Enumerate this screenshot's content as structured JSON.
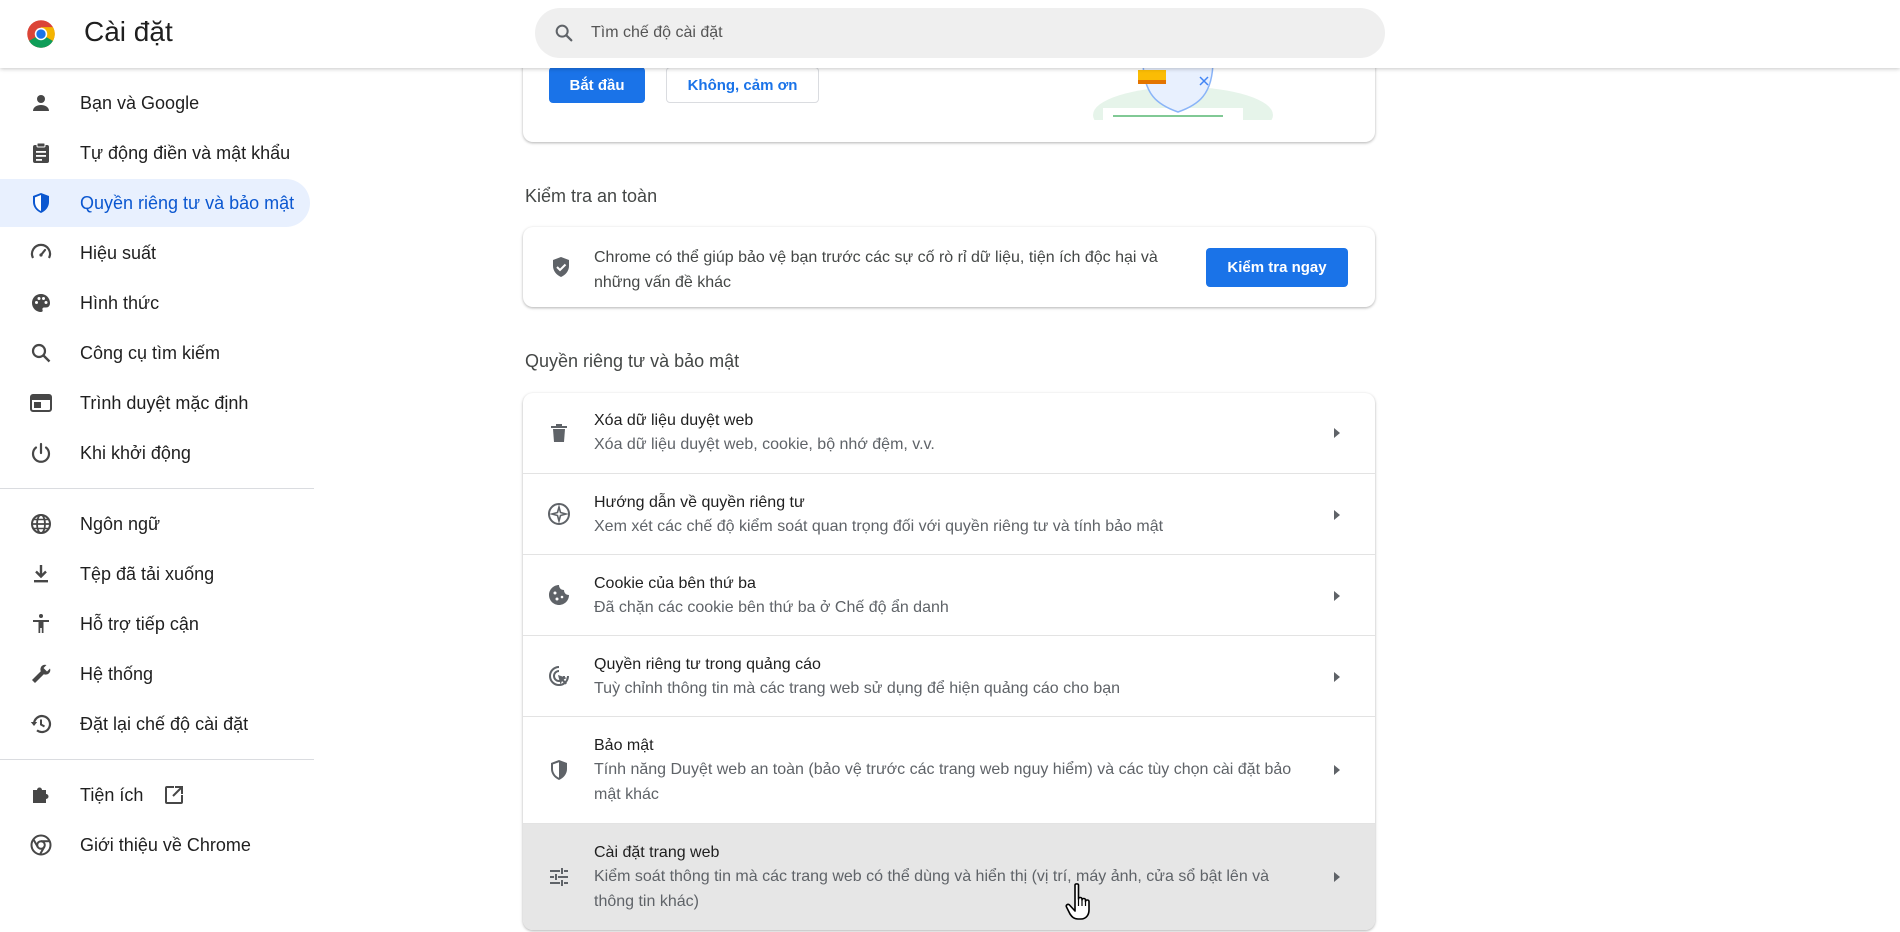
{
  "header": {
    "title": "Cài đặt",
    "search_placeholder": "Tìm chế độ cài đặt"
  },
  "sidebar": {
    "items": [
      {
        "label": "Bạn và Google",
        "icon": "person-icon"
      },
      {
        "label": "Tự động điền và mật khẩu",
        "icon": "clipboard-icon"
      },
      {
        "label": "Quyền riêng tư và bảo mật",
        "icon": "shield-icon",
        "active": true
      },
      {
        "label": "Hiệu suất",
        "icon": "speedometer-icon"
      },
      {
        "label": "Hình thức",
        "icon": "palette-icon"
      },
      {
        "label": "Công cụ tìm kiếm",
        "icon": "search-icon"
      },
      {
        "label": "Trình duyệt mặc định",
        "icon": "browser-icon"
      },
      {
        "label": "Khi khởi động",
        "icon": "power-icon"
      },
      {
        "label": "Ngôn ngữ",
        "icon": "globe-icon"
      },
      {
        "label": "Tệp đã tải xuống",
        "icon": "download-icon"
      },
      {
        "label": "Hỗ trợ tiếp cận",
        "icon": "accessibility-icon"
      },
      {
        "label": "Hệ thống",
        "icon": "wrench-icon"
      },
      {
        "label": "Đặt lại chế độ cài đặt",
        "icon": "history-icon"
      },
      {
        "label": "Tiện ích",
        "icon": "puzzle-icon"
      },
      {
        "label": "Giới thiệu về Chrome",
        "icon": "chrome-icon"
      }
    ]
  },
  "promo": {
    "start_label": "Bắt đầu",
    "no_thanks_label": "Không, cảm ơn"
  },
  "safety_check": {
    "section_title": "Kiểm tra an toàn",
    "description_line1": "Chrome có thể giúp bảo vệ bạn trước các sự cố rò rỉ dữ liệu, tiện ích độc hại và",
    "description_line2": "những vấn đề khác",
    "button_label": "Kiểm tra ngay"
  },
  "privacy": {
    "section_title": "Quyền riêng tư và bảo mật",
    "rows": [
      {
        "title": "Xóa dữ liệu duyệt web",
        "sub": "Xóa dữ liệu duyệt web, cookie, bộ nhớ đệm, v.v.",
        "icon": "trash-icon"
      },
      {
        "title": "Hướng dẫn về quyền riêng tư",
        "sub": "Xem xét các chế độ kiểm soát quan trọng đối với quyền riêng tư và tính bảo mật",
        "icon": "compass-icon"
      },
      {
        "title": "Cookie của bên thứ ba",
        "sub": "Đã chặn các cookie bên thứ ba ở Chế độ ẩn danh",
        "icon": "cookie-icon"
      },
      {
        "title": "Quyền riêng tư trong quảng cáo",
        "sub": "Tuỳ chỉnh thông tin mà các trang web sử dụng để hiện quảng cáo cho bạn",
        "icon": "ad-privacy-icon"
      },
      {
        "title": "Bảo mật",
        "sub": "Tính năng Duyệt web an toàn (bảo vệ trước các trang web nguy hiểm) và các tùy chọn cài đặt bảo mật khác",
        "icon": "security-shield-icon"
      },
      {
        "title": "Cài đặt trang web",
        "sub": "Kiểm soát thông tin mà các trang web có thể dùng và hiển thị (vị trí, máy ảnh, cửa sổ bật lên và thông tin khác)",
        "icon": "tune-icon"
      }
    ]
  }
}
